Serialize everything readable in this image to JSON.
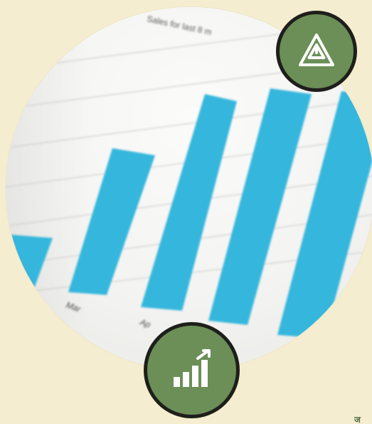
{
  "photo": {
    "title": "Sales for last 8 m",
    "x_labels": [
      "Mar",
      "Ap"
    ]
  },
  "badges": {
    "top": {
      "icon": "triforce-triangle-icon",
      "color": "#6b8f57",
      "border": "#1e1e1b"
    },
    "bottom": {
      "icon": "growth-bar-chart-icon",
      "color": "#6b8f57",
      "border": "#1e1e1b"
    }
  },
  "brand": {
    "fragment": "ज"
  },
  "colors": {
    "background": "#f4edcf",
    "bars": "#35b6dc"
  }
}
